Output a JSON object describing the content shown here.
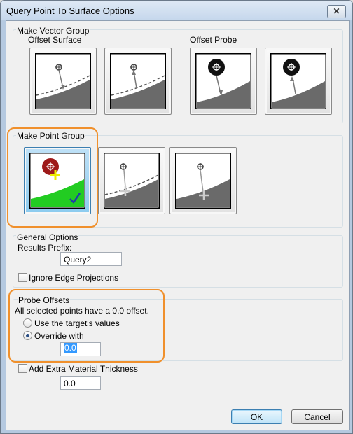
{
  "window": {
    "title": "Query Point To Surface Options",
    "close_glyph": "✕"
  },
  "vector_group": {
    "label": "Make Vector Group",
    "offset_surface_label": "Offset Surface",
    "offset_probe_label": "Offset Probe",
    "tiles": [
      {
        "name": "offset-surface-to-surface-icon",
        "state": "normal"
      },
      {
        "name": "offset-surface-from-surface-icon",
        "state": "normal"
      },
      {
        "name": "offset-probe-to-surface-icon",
        "state": "normal"
      },
      {
        "name": "offset-probe-from-surface-icon",
        "state": "normal"
      }
    ]
  },
  "point_group": {
    "label": "Make Point Group",
    "tiles": [
      {
        "name": "point-on-surface-icon",
        "state": "selected"
      },
      {
        "name": "point-offset-surface-icon",
        "state": "normal"
      },
      {
        "name": "point-along-vector-icon",
        "state": "normal"
      }
    ]
  },
  "general_options": {
    "label": "General Options",
    "results_prefix_label": "Results Prefix:",
    "results_prefix_value": "Query2",
    "ignore_edge_label": "Ignore Edge Projections",
    "ignore_edge_checked": false
  },
  "probe_offsets": {
    "label": "Probe Offsets",
    "info": "All selected points have a 0.0 offset.",
    "use_target_label": "Use the target's values",
    "override_label": "Override with",
    "override_value": "0.0",
    "selected_option": "override"
  },
  "extra_material": {
    "label": "Add Extra Material Thickness",
    "checked": false,
    "value": "0.0"
  },
  "buttons": {
    "ok": "OK",
    "cancel": "Cancel"
  },
  "colors": {
    "highlight": "#f0902c",
    "selected_tile": "#8ccbef",
    "surface_green": "#22cc22"
  }
}
